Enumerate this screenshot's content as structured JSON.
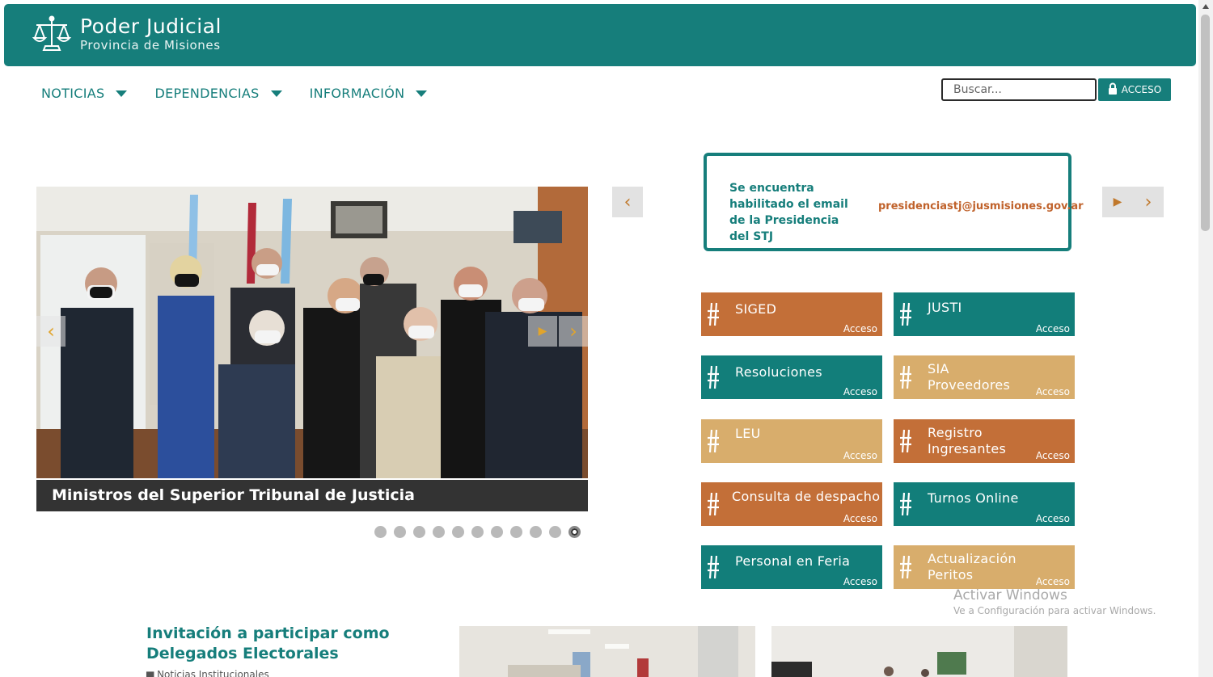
{
  "header": {
    "title": "Poder Judicial",
    "subtitle": "Provincia de Misiones",
    "logo": "scales-of-justice-icon"
  },
  "nav": {
    "items": [
      {
        "label": "NOTICIAS"
      },
      {
        "label": "DEPENDENCIAS"
      },
      {
        "label": "INFORMACIÓN"
      }
    ]
  },
  "search": {
    "placeholder": "Buscar..."
  },
  "access_button": {
    "label": "ACCESO",
    "icon": "lock-icon"
  },
  "carousel": {
    "caption": "Ministros del Superior Tribunal de Justicia",
    "prev_icon": "chevron-left-icon",
    "next_icon": "chevron-right-icon",
    "play_icon": "play-icon",
    "dot_count": 11,
    "active_dot": 11
  },
  "banner": {
    "left_text": "Se encuentra habilitado el email de la Presidencia del STJ",
    "email": "presidenciastj@jusmisiones.gov.ar"
  },
  "tiles": [
    {
      "label": "SIGED",
      "access": "Acceso"
    },
    {
      "label": "JUSTI",
      "access": "Acceso"
    },
    {
      "label": "Resoluciones",
      "access": "Acceso"
    },
    {
      "label": "SIA Proveedores",
      "access": "Acceso"
    },
    {
      "label": "LEU",
      "access": "Acceso"
    },
    {
      "label": "Registro Ingresantes",
      "access": "Acceso"
    },
    {
      "label": "Consulta de despacho",
      "access": "Acceso"
    },
    {
      "label": "Turnos Online",
      "access": "Acceso"
    },
    {
      "label": "Personal en Feria",
      "access": "Acceso"
    },
    {
      "label": "Actualización Peritos",
      "access": "Acceso"
    }
  ],
  "tile_icon": "paragraph-hash-icon",
  "news": {
    "title": "Invitación a participar como Delegados Electorales",
    "category": "Noticias Institucionales"
  },
  "windows_watermark": {
    "line1": "Activar Windows",
    "line2": "Ve a Configuración para activar Windows."
  },
  "colors": {
    "brand": "#167e7b",
    "orange": "#c36f38",
    "sand": "#d8ad6c",
    "email": "#c0622b"
  }
}
